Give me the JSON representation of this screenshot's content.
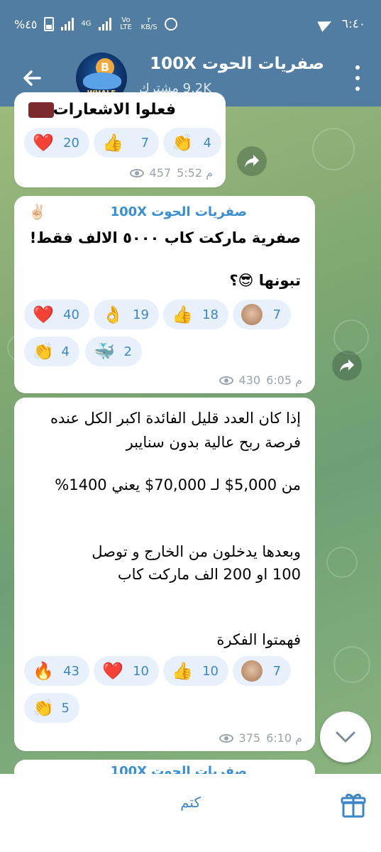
{
  "status_bar": {
    "time": "٦:٤٠",
    "battery": "%٤٥",
    "network": "4G",
    "volte": "Vo LTE",
    "speed_value": "٢",
    "speed_unit": "KB/S"
  },
  "header": {
    "title": "صفريات الحوت 100X ✌🏻",
    "subscribers": "9.2K مشترك",
    "avatar_coin": "B",
    "avatar_logo": "WHALE"
  },
  "messages": [
    {
      "partial_text": "فعلوا الاشعارات",
      "reactions": [
        {
          "emoji": "❤️",
          "count": "20"
        },
        {
          "emoji": "👍",
          "count": "7"
        },
        {
          "emoji": "👏",
          "count": "4"
        }
      ],
      "views": "457",
      "time": "5:52 م"
    },
    {
      "author": "صفريات الحوت 100X",
      "author_emoji": "✌🏻",
      "lines": [
        "صفرية ماركت كاب ٥٠٠٠ الالف فقط!",
        "",
        "تبونها 😎؟"
      ],
      "reactions": [
        {
          "emoji": "❤️",
          "count": "40"
        },
        {
          "emoji": "👌",
          "count": "19"
        },
        {
          "emoji": "👍",
          "count": "18"
        },
        {
          "emoji": "avatar",
          "count": "7"
        },
        {
          "emoji": "👏",
          "count": "4"
        },
        {
          "emoji": "🐳",
          "count": "2"
        }
      ],
      "views": "430",
      "time": "6:05 م"
    },
    {
      "lines": [
        "إذا كان العدد قليل الفائدة اكبر الكل عنده",
        "فرصة ربح عالية بدون سنايبر",
        "",
        "من 5,000$ لـ 70,000$ يعني 1400%",
        "",
        "",
        "وبعدها يدخلون من الخارج و توصل",
        "100 او 200 الف ماركت كاب",
        "",
        "",
        "فهمتوا الفكرة"
      ],
      "reactions": [
        {
          "emoji": "🔥",
          "count": "43"
        },
        {
          "emoji": "❤️",
          "count": "10"
        },
        {
          "emoji": "👍",
          "count": "10"
        },
        {
          "emoji": "avatar",
          "count": "7"
        },
        {
          "emoji": "👏",
          "count": "5"
        }
      ],
      "views": "375",
      "time": "6:10 م"
    },
    {
      "partial_author": "صفريات الحوت 100X"
    }
  ],
  "bottom_bar": {
    "mute_label": "كتم"
  },
  "colors": {
    "header": "#517da2",
    "accent": "#3d86c6",
    "reaction_bg": "#e8f1fb"
  }
}
